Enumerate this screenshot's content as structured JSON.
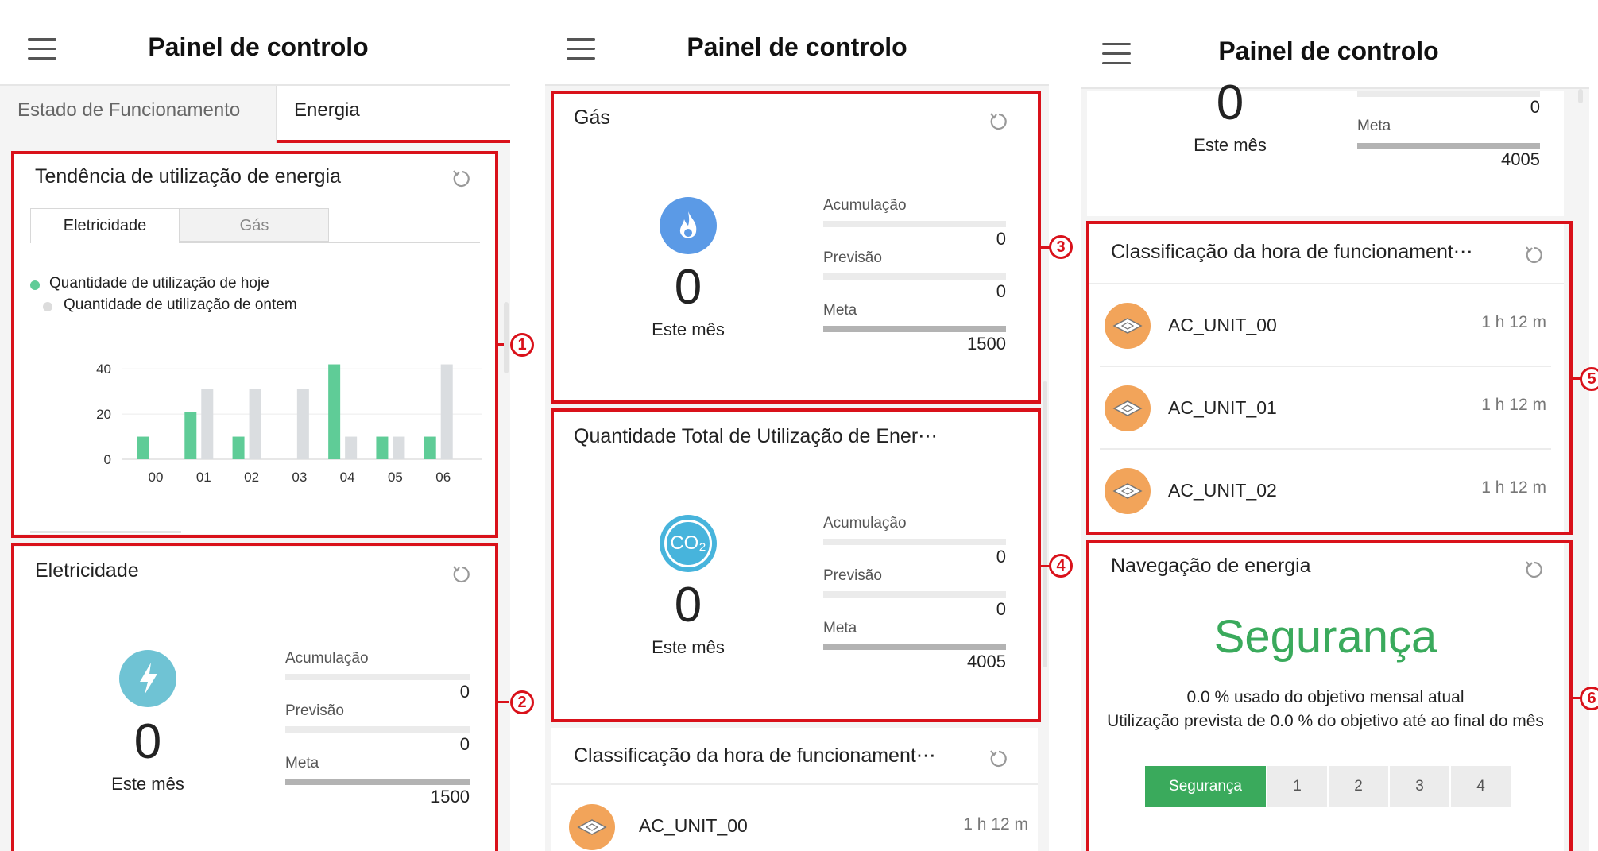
{
  "colors": {
    "red_box": "#d9111a",
    "green_bar": "#5fcc97",
    "gray_bar": "#dadde0",
    "safety_green": "#3aaa5c",
    "electricity_icon": "#6fc3d4",
    "gas_icon": "#5b9ae6",
    "co2_icon": "#47b4dc",
    "ac_avatar": "#f2a45a"
  },
  "app": {
    "title": "Painel de controlo",
    "menu_icon": "hamburger-menu-icon",
    "refresh_icon": "refresh-icon"
  },
  "screen1": {
    "tabs": [
      {
        "label": "Estado de Funcionamento",
        "active": false
      },
      {
        "label": "Energia",
        "active": true
      }
    ],
    "trend_card": {
      "title": "Tendência de utilização de energia",
      "subtabs": [
        {
          "label": "Eletricidade",
          "active": true
        },
        {
          "label": "Gás",
          "active": false
        }
      ],
      "legend_today": "Quantidade de utilização de hoje",
      "legend_yesterday": "Quantidade de utilização de ontem"
    },
    "electricity_card": {
      "title": "Eletricidade",
      "value": "0",
      "period": "Este mês",
      "accumulation_label": "Acumulação",
      "accumulation_value": "0",
      "forecast_label": "Previsão",
      "forecast_value": "0",
      "target_label": "Meta",
      "target_value": "1500"
    },
    "callouts": [
      "1",
      "2"
    ]
  },
  "screen2": {
    "gas_card": {
      "title": "Gás",
      "value": "0",
      "period": "Este mês",
      "accumulation_label": "Acumulação",
      "accumulation_value": "0",
      "forecast_label": "Previsão",
      "forecast_value": "0",
      "target_label": "Meta",
      "target_value": "1500"
    },
    "total_card": {
      "title": "Quantidade Total de Utilização de Ener⋯",
      "icon_text": "CO₂",
      "value": "0",
      "period": "Este mês",
      "accumulation_label": "Acumulação",
      "accumulation_value": "0",
      "forecast_label": "Previsão",
      "forecast_value": "0",
      "target_label": "Meta",
      "target_value": "4005"
    },
    "ranking_card": {
      "title": "Classificação da hora de funcionament⋯",
      "rows": [
        {
          "name": "AC_UNIT_00",
          "time": "1 h 12 m"
        }
      ]
    },
    "callouts": [
      "3",
      "4"
    ]
  },
  "screen3": {
    "top_partial": {
      "value": "0",
      "period": "Este mês",
      "accumulation_value": "0",
      "target_label": "Meta",
      "target_value": "4005"
    },
    "ranking_card": {
      "title": "Classificação da hora de funcionament⋯",
      "rows": [
        {
          "name": "AC_UNIT_00",
          "time": "1 h 12 m"
        },
        {
          "name": "AC_UNIT_01",
          "time": "1 h 12 m"
        },
        {
          "name": "AC_UNIT_02",
          "time": "1 h 12 m"
        }
      ]
    },
    "navigation_card": {
      "title": "Navegação de energia",
      "status": "Segurança",
      "line1": "0.0 % usado do objetivo mensal atual",
      "line2": "Utilização prevista de 0.0 % do objetivo até ao final do mês",
      "levels": [
        {
          "label": "Segurança",
          "active": true
        },
        {
          "label": "1",
          "active": false
        },
        {
          "label": "2",
          "active": false
        },
        {
          "label": "3",
          "active": false
        },
        {
          "label": "4",
          "active": false
        }
      ]
    },
    "callouts": [
      "5",
      "6"
    ]
  },
  "chart_data": {
    "type": "bar",
    "title": "",
    "xlabel": "",
    "ylabel": "",
    "categories": [
      "00",
      "01",
      "02",
      "03",
      "04",
      "05",
      "06"
    ],
    "yticks": [
      "0",
      "20",
      "40"
    ],
    "ylim": [
      0,
      45
    ],
    "series": [
      {
        "name": "Quantidade de utilização de hoje",
        "color": "#5fcc97",
        "values": [
          10,
          21,
          10,
          0,
          42,
          10,
          10
        ]
      },
      {
        "name": "Quantidade de utilização de ontem",
        "color": "#dadde0",
        "values": [
          0,
          31,
          31,
          31,
          10,
          10,
          42
        ]
      }
    ],
    "grid": true,
    "legend": "top-left"
  }
}
